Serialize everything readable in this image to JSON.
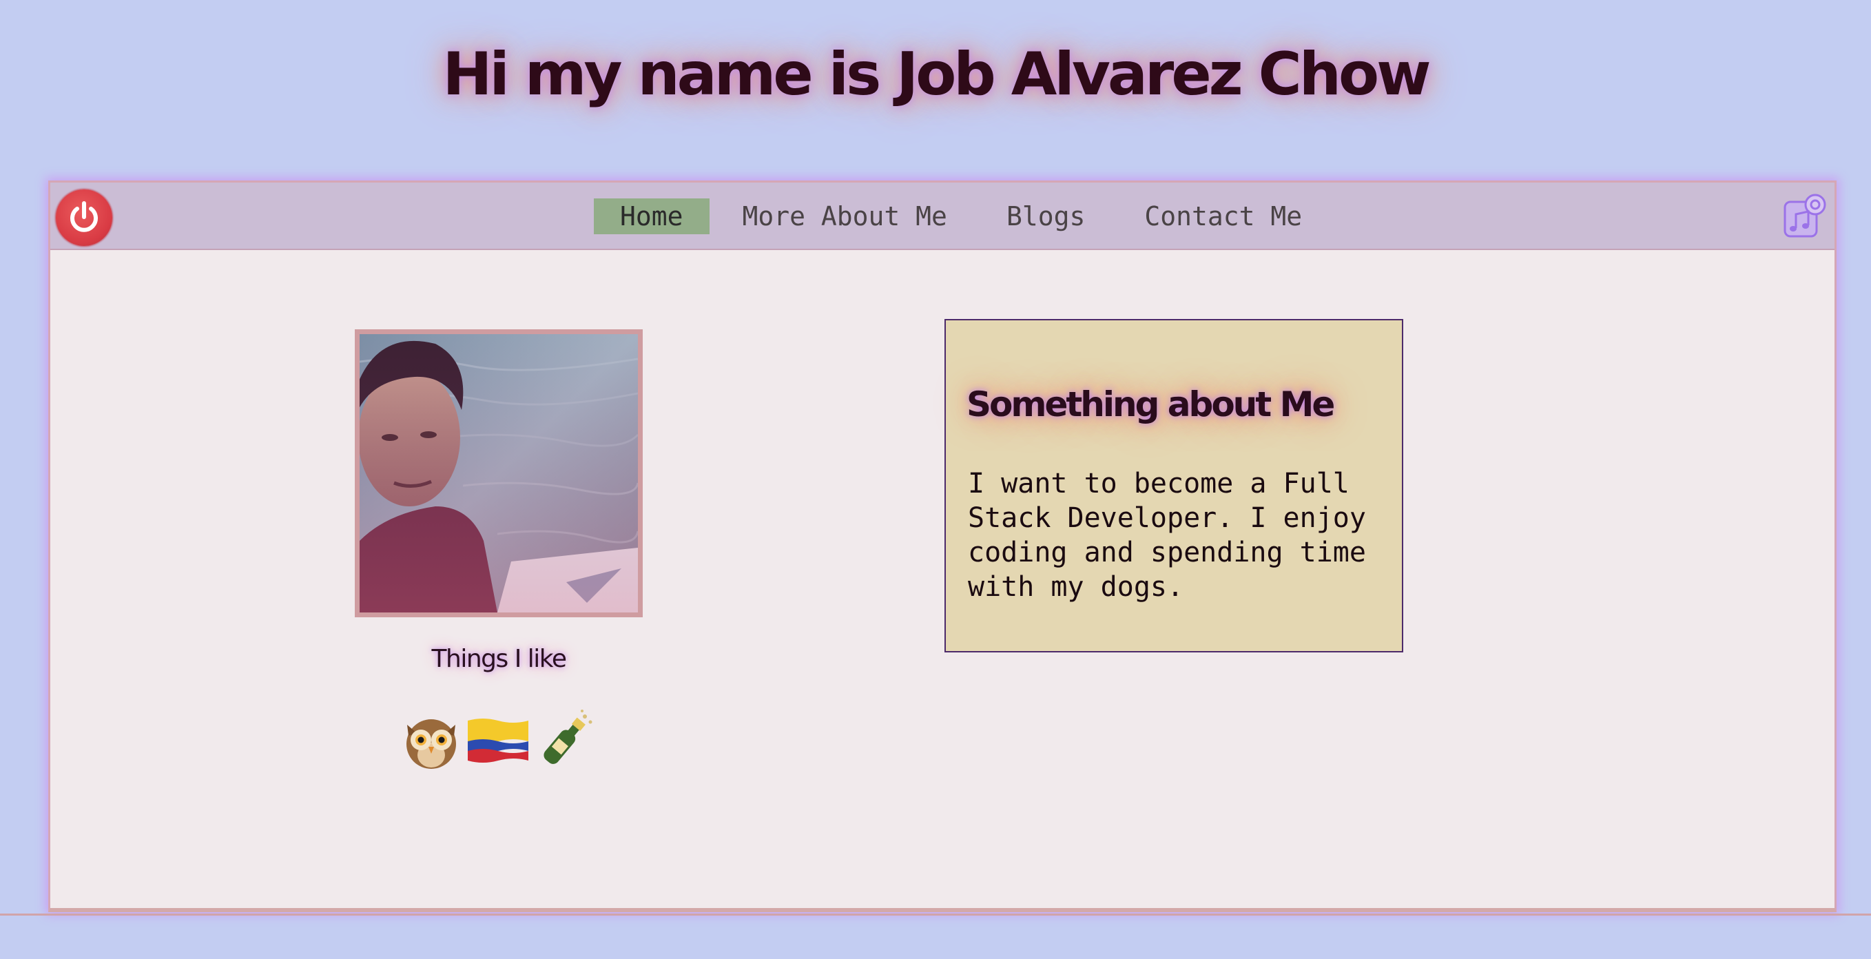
{
  "header": {
    "title": "Hi my name is Job Alvarez Chow"
  },
  "navbar": {
    "items": [
      {
        "label": "Home",
        "active": true
      },
      {
        "label": "More About Me",
        "active": false
      },
      {
        "label": "Blogs",
        "active": false
      },
      {
        "label": "Contact Me",
        "active": false
      }
    ],
    "left_icon": "power-icon",
    "right_icon": "music-icon"
  },
  "profile": {
    "photo_alt": "profile photo",
    "likes_heading": "Things I like",
    "likes": [
      {
        "icon": "owl-icon",
        "glyph": "🦉"
      },
      {
        "icon": "colombia-flag-icon",
        "glyph": "🇨🇴"
      },
      {
        "icon": "champagne-bottle-icon",
        "glyph": "🍾"
      }
    ]
  },
  "about": {
    "heading": "Something about Me",
    "text": "I want to become a Full Stack Developer. I enjoy coding and spending time with my dogs."
  },
  "colors": {
    "background": "#c3cdf2",
    "navbar": "#cbbdd5",
    "nav_active": "#93ad89",
    "card": "#e4d7b2",
    "power_button": "#d93b44"
  }
}
